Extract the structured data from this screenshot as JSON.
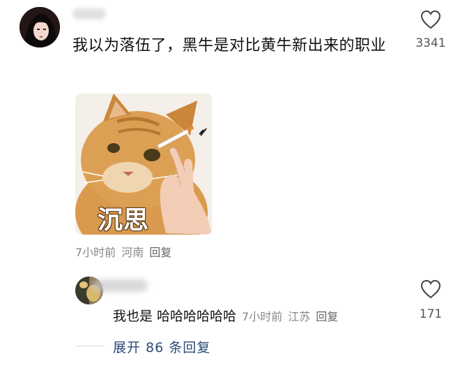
{
  "comment": {
    "text": "我以为落伍了，黑牛是对比黄牛新出来的职业",
    "like_count": "3341",
    "sticker_caption": "沉思",
    "meta": {
      "time": "7小时前",
      "location": "河南",
      "reply_label": "回复"
    }
  },
  "reply": {
    "text": "我也是 哈哈哈哈哈哈",
    "like_count": "171",
    "meta": {
      "time": "7小时前",
      "location": "江苏",
      "reply_label": "回复"
    }
  },
  "expand": {
    "label": "展开 86 条回复"
  },
  "icons": {
    "like": "heart-outline-icon"
  },
  "colors": {
    "link": "#2b4a77",
    "meta": "#888888"
  }
}
